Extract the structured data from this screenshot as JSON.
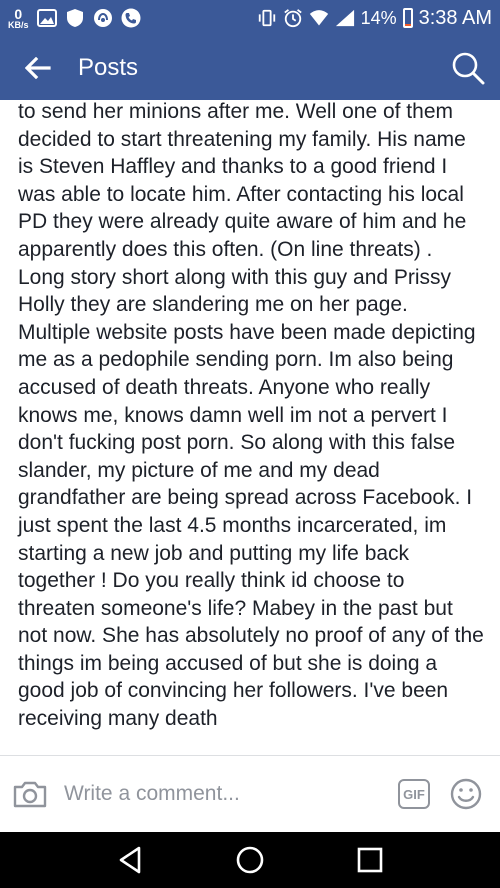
{
  "status_bar": {
    "data_rate_value": "0",
    "data_rate_unit": "KB/s",
    "battery_percent": "14%",
    "battery_level": 0.14,
    "time": "3:38 AM",
    "icons": [
      "gallery-icon",
      "shield-icon",
      "signal-app-icon",
      "phone-icon",
      "vibrate-icon",
      "alarm-icon",
      "wifi-icon",
      "cell-signal-icon",
      "battery-icon"
    ]
  },
  "app_bar": {
    "title": "Posts",
    "back_icon": "arrow-left-icon",
    "search_icon": "search-icon"
  },
  "post": {
    "text": "to send her minions after me. Well one of them decided to start threatening my family. His name is Steven Haffley and thanks to a good friend I was able to locate him. After contacting his local PD they were already quite aware of him and he apparently does this often.  (On line threats) . Long story short along with this guy and Prissy Holly they are slandering me on her page. Multiple website posts have been made depicting me as a pedophile sending porn. Im also being accused of death threats.  Anyone who really knows me, knows damn well im not a pervert I don't fucking post porn.  So along with this false slander,  my picture of me and my dead grandfather are being spread across Facebook.  I just spent the last 4.5 months incarcerated,  im starting a new job and putting my life back together ! Do you really think id choose to threaten someone's life? Mabey in the past but not now.  She has absolutely no proof of any of the things im being accused of but she is doing a good job of convincing her followers.  I've been receiving many death"
  },
  "comment_bar": {
    "placeholder": "Write a comment...",
    "gif_label": "GIF",
    "camera_icon": "camera-icon",
    "emoji_icon": "emoji-icon"
  },
  "nav_bar": {
    "icons": [
      "back-triangle-icon",
      "home-circle-icon",
      "recents-square-icon"
    ]
  },
  "colors": {
    "brand": "#3b5998",
    "text": "#1d2129",
    "muted": "#90949c",
    "battery_low": "#f05a28"
  }
}
